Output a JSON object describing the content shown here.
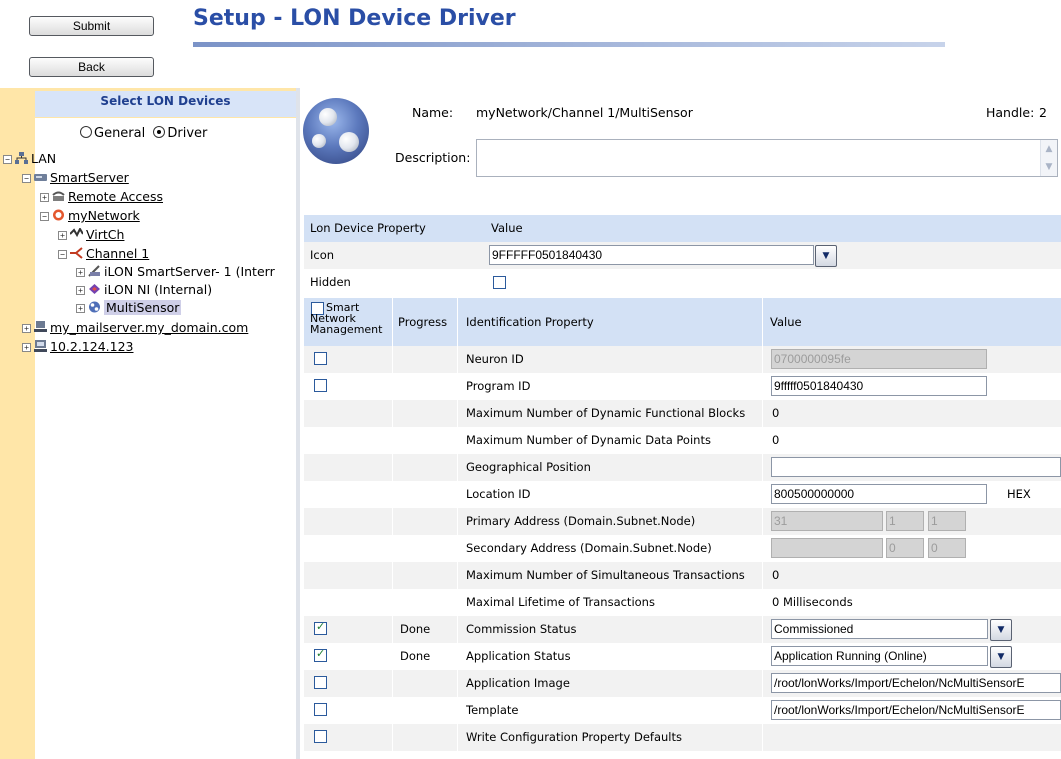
{
  "toolbar": {
    "submit_label": "Submit",
    "back_label": "Back"
  },
  "page": {
    "title": "Setup - LON Device Driver"
  },
  "left_panel": {
    "header": "Select LON Devices",
    "view_mode": {
      "general_label": "General",
      "driver_label": "Driver",
      "selected": "Driver"
    },
    "tree": {
      "lan": "LAN",
      "smartserver": "SmartServer",
      "remote_access": "Remote Access",
      "mynetwork": "myNetwork",
      "virtch": "VirtCh",
      "channel1": "Channel 1",
      "ilon_smartserver": "iLON SmartServer- 1 (Interr",
      "ilon_ni": "iLON NI (Internal)",
      "multisensor": "MultiSensor",
      "mailserver": "my_mailserver.my_domain.com",
      "ip_host": "10.2.124.123"
    }
  },
  "device": {
    "name_label": "Name:",
    "name_value": "myNetwork/Channel 1/MultiSensor",
    "handle_label": "Handle:",
    "handle_value": "2",
    "description_label": "Description:"
  },
  "properties": {
    "header_property": "Lon Device Property",
    "header_value": "Value",
    "icon_label": "Icon",
    "icon_value": "9FFFFF0501840430",
    "hidden_label": "Hidden"
  },
  "id_table": {
    "col_smart": "Smart Network Management",
    "col_progress": "Progress",
    "col_property": "Identification Property",
    "col_value": "Value",
    "rows": {
      "neuron_id": {
        "label": "Neuron ID",
        "value": "0700000095fe"
      },
      "program_id": {
        "label": "Program ID",
        "value": "9fffff0501840430"
      },
      "max_fb": {
        "label": "Maximum Number of Dynamic Functional Blocks",
        "value": "0"
      },
      "max_dp": {
        "label": "Maximum Number of Dynamic Data Points",
        "value": "0"
      },
      "geo": {
        "label": "Geographical Position",
        "value": ""
      },
      "location": {
        "label": "Location ID",
        "value": "800500000000",
        "unit": "HEX"
      },
      "primary": {
        "label": "Primary Address (Domain.Subnet.Node)",
        "domain": "31",
        "subnet": "1",
        "node": "1"
      },
      "secondary": {
        "label": "Secondary Address (Domain.Subnet.Node)",
        "domain": "",
        "subnet": "0",
        "node": "0"
      },
      "max_tx": {
        "label": "Maximum Number of Simultaneous Transactions",
        "value": "0"
      },
      "lifetime": {
        "label": "Maximal Lifetime of Transactions",
        "value": "0 Milliseconds"
      },
      "commission": {
        "label": "Commission Status",
        "progress": "Done",
        "value": "Commissioned"
      },
      "app_status": {
        "label": "Application Status",
        "progress": "Done",
        "value": "Application Running (Online)"
      },
      "app_image": {
        "label": "Application Image",
        "value": "/root/lonWorks/Import/Echelon/NcMultiSensorE"
      },
      "template": {
        "label": "Template",
        "value": "/root/lonWorks/Import/Echelon/NcMultiSensorE"
      },
      "write_cp": {
        "label": "Write Configuration Property Defaults"
      }
    }
  },
  "colors": {
    "title": "#2a4ea6",
    "header_bg": "#d3e1f5",
    "tree_strip": "#ffe6a8"
  }
}
